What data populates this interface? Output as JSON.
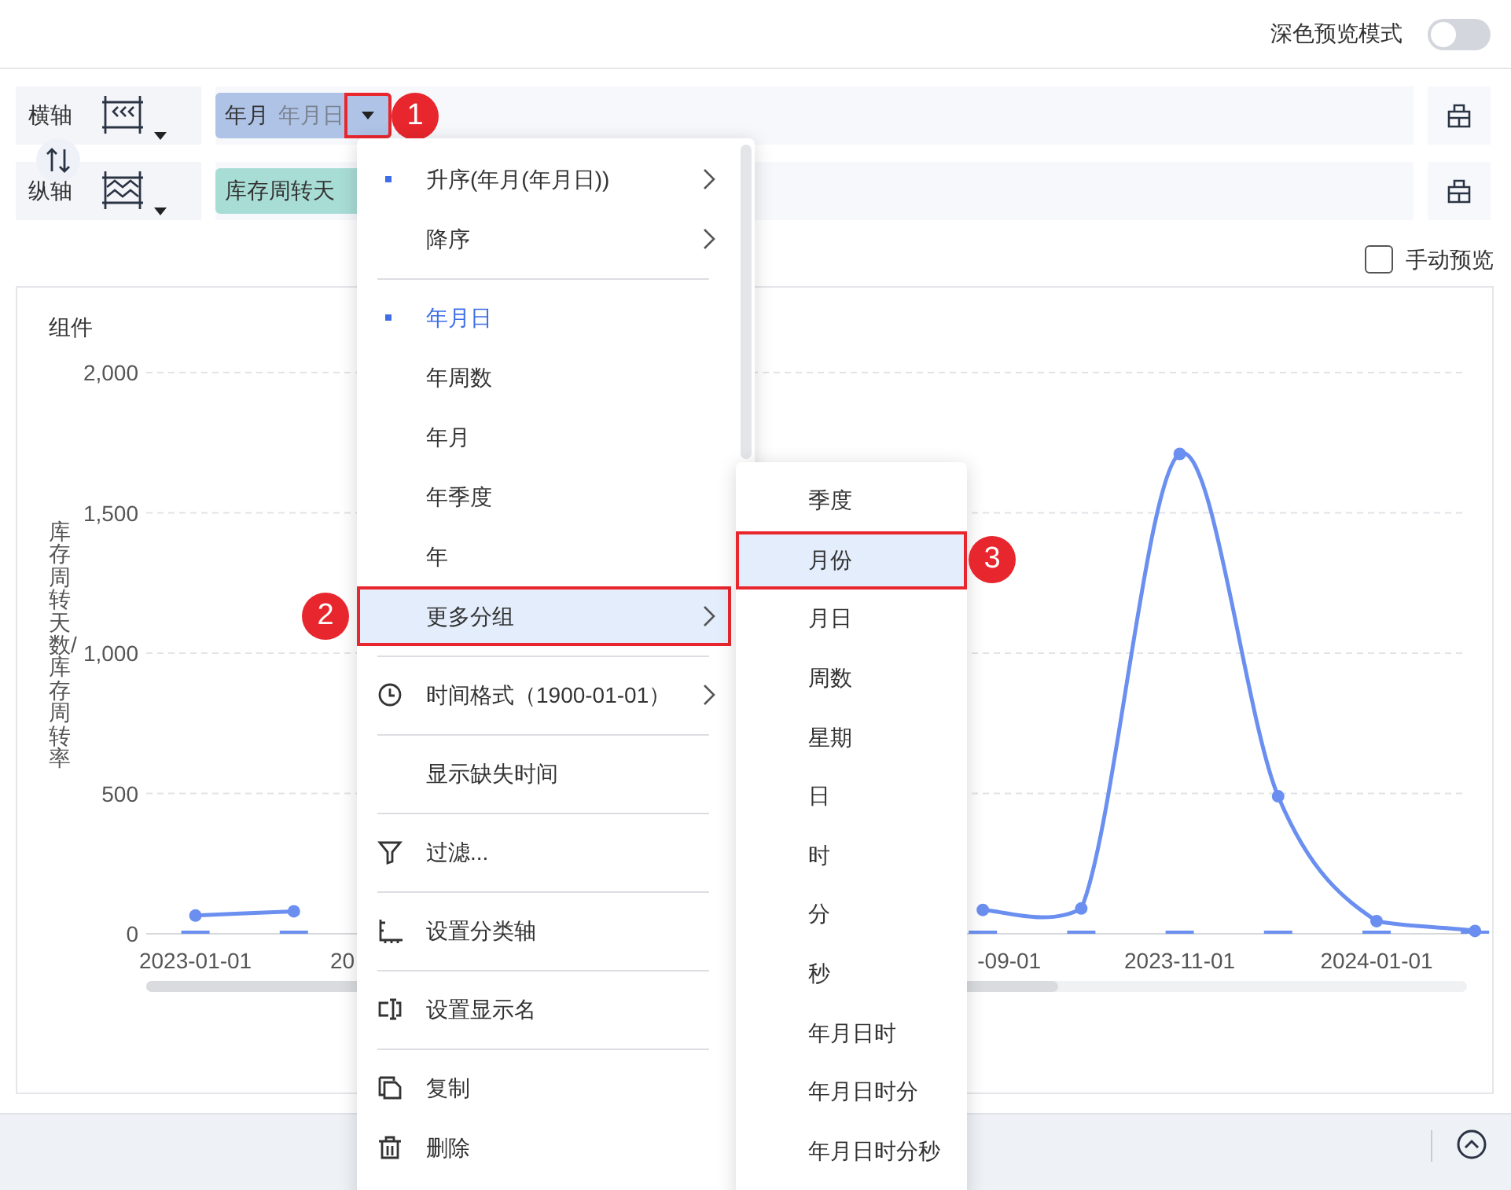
{
  "top_bar": {
    "dark_preview_label": "深色预览模式",
    "dark_preview_on": false
  },
  "axes": [
    {
      "label": "横轴",
      "kind": "dimension",
      "field": {
        "name": "年月",
        "detail": "年月日"
      },
      "callout": "1"
    },
    {
      "label": "纵轴",
      "kind": "measure",
      "field": {
        "name": "库存周转天"
      }
    }
  ],
  "manual_preview": {
    "label": "手动预览",
    "checked": false
  },
  "chart": {
    "title": "组件",
    "cut_axis_labels": [
      "20",
      "-09-01"
    ],
    "chart_data": {
      "type": "line",
      "ylabel": "库存周转天数/库存周转率",
      "categories": [
        "2023-01-01",
        null,
        null,
        null,
        null,
        null,
        null,
        null,
        null,
        null,
        "2023-11-01",
        null,
        "2024-01-01",
        null
      ],
      "ylim": [
        0,
        2000
      ],
      "grid": true,
      "yticks": [
        {
          "value": 0,
          "label": "0"
        },
        {
          "value": 500,
          "label": "500"
        },
        {
          "value": 1000,
          "label": "1,000"
        },
        {
          "value": 1500,
          "label": "1,500"
        },
        {
          "value": 2000,
          "label": "2,000"
        }
      ],
      "series": [
        {
          "color": "#6b8ff0",
          "marker": "circle",
          "values": [
            65,
            80,
            null,
            null,
            null,
            null,
            null,
            null,
            85,
            90,
            1710,
            490,
            45,
            10
          ]
        }
      ]
    }
  },
  "context_menu": {
    "items": [
      {
        "kind": "sort",
        "label": "升序(年月(年月日))",
        "checked": true,
        "has_submenu": true,
        "highlighted": false
      },
      {
        "kind": "sort",
        "label": "降序",
        "checked": false,
        "has_submenu": true,
        "highlighted": false
      },
      {
        "kind": "divider"
      },
      {
        "kind": "group",
        "label": "年月日",
        "checked": true,
        "has_submenu": false,
        "highlighted": false
      },
      {
        "kind": "group",
        "label": "年周数",
        "checked": false,
        "has_submenu": false,
        "highlighted": false
      },
      {
        "kind": "group",
        "label": "年月",
        "checked": false,
        "has_submenu": false,
        "highlighted": false
      },
      {
        "kind": "group",
        "label": "年季度",
        "checked": false,
        "has_submenu": false,
        "highlighted": false
      },
      {
        "kind": "group",
        "label": "年",
        "checked": false,
        "has_submenu": false,
        "highlighted": false
      },
      {
        "kind": "group",
        "label": "更多分组",
        "checked": false,
        "has_submenu": true,
        "highlighted": true,
        "callout": "2"
      },
      {
        "kind": "divider"
      },
      {
        "kind": "time_format",
        "label": "时间格式（1900-01-01）",
        "checked": false,
        "has_submenu": true,
        "highlighted": false
      },
      {
        "kind": "divider"
      },
      {
        "kind": "plain",
        "label": "显示缺失时间",
        "checked": false,
        "has_submenu": false,
        "highlighted": false
      },
      {
        "kind": "divider"
      },
      {
        "kind": "filter",
        "label": "过滤...",
        "checked": false,
        "has_submenu": false,
        "highlighted": false
      },
      {
        "kind": "divider"
      },
      {
        "kind": "category_axis",
        "label": "设置分类轴",
        "checked": false,
        "has_submenu": false,
        "highlighted": false
      },
      {
        "kind": "divider"
      },
      {
        "kind": "rename",
        "label": "设置显示名",
        "checked": false,
        "has_submenu": false,
        "highlighted": false
      },
      {
        "kind": "divider"
      },
      {
        "kind": "copy",
        "label": "复制",
        "checked": false,
        "has_submenu": false,
        "highlighted": false
      },
      {
        "kind": "delete",
        "label": "删除",
        "checked": false,
        "has_submenu": false,
        "highlighted": false
      }
    ]
  },
  "submenu": {
    "items": [
      {
        "label": "季度",
        "highlighted": false
      },
      {
        "label": "月份",
        "highlighted": true,
        "callout": "3"
      },
      {
        "label": "月日",
        "highlighted": false
      },
      {
        "label": "周数",
        "highlighted": false
      },
      {
        "label": "星期",
        "highlighted": false
      },
      {
        "label": "日",
        "highlighted": false
      },
      {
        "label": "时",
        "highlighted": false
      },
      {
        "label": "分",
        "highlighted": false
      },
      {
        "label": "秒",
        "highlighted": false
      },
      {
        "label": "年月日时",
        "highlighted": false
      },
      {
        "label": "年月日时分",
        "highlighted": false
      },
      {
        "label": "年月日时分秒",
        "highlighted": false
      }
    ]
  }
}
